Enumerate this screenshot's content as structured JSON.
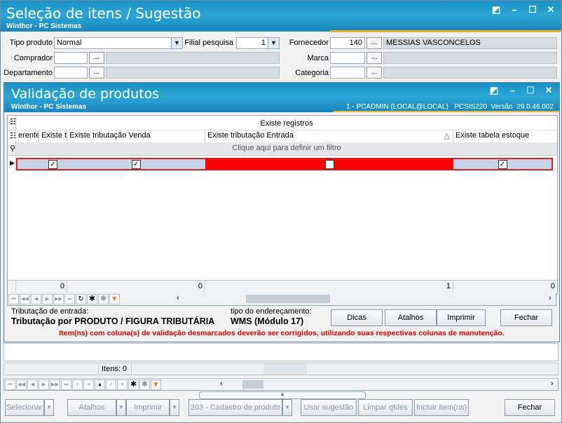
{
  "window": {
    "title": "Seleção de itens / Sugestão",
    "subtitle": "Winthor - PC Sistemas"
  },
  "filters": {
    "tipo_produto_label": "Tipo produto",
    "tipo_produto_value": "Normal",
    "filial_label": "Filial pesquisa",
    "filial_value": "1",
    "fornecedor_label": "Fornecedor",
    "fornecedor_code": "140",
    "fornecedor_name": "MESSIAS VASCONCELOS",
    "comprador_label": "Comprador",
    "marca_label": "Marca",
    "departamento_label": "Departamento",
    "categoria_label": "Categoria",
    "dots": "..."
  },
  "dialog": {
    "title": "Validação de produtos",
    "subtitle": "Winthor - PC Sistemas",
    "info": "1 - PCADMIN (LOCAL@LOCAL)   PCSIS220  Versão  29.0.46.002",
    "grid": {
      "band_header": "Existe registros",
      "columns": [
        "erente",
        "Existe t",
        "Existe tributação Venda",
        "Existe tributação Entrada",
        "Existe tabela estoque"
      ],
      "sort_indicator": "△",
      "filter_row": "Clique aqui para definir um filtro",
      "row": {
        "c1": "",
        "c2": "✓",
        "c3": "✓",
        "c4": "",
        "c5": "✓"
      },
      "row_error_color": "#ff0000",
      "totals": {
        "t1": "0",
        "t2": "0",
        "t3": "1",
        "t4": "0"
      }
    },
    "trib_entrada_label": "Tributação de entrada:",
    "trib_entrada_value": "Tributação por PRODUTO / FIGURA TRIBUTÁRIA",
    "tipo_end_label": "tipo do endereçamento:",
    "tipo_end_value": "WMS (Módulo 17)",
    "warning": "Item(ns) com coluna(s) de validação desmarcados deverão ser corrigidos, utilizando suas respectivas colunas de manutenção.",
    "buttons": {
      "dicas": "Dicas",
      "atalhos": "Atalhos",
      "imprimir": "Imprimir",
      "fechar": "Fechar"
    }
  },
  "status": {
    "itens": "Itens: 0"
  },
  "toolbar": {
    "selecionar": "Selecionar",
    "atalhos": "Atalhos",
    "imprimir": "Imprimir",
    "cadastro": "203 - Cadastro de produto",
    "usar_sugestao": "Usar sugestão",
    "limpar_qtdes": "Limpar qtdes",
    "incluir_itens": "Incluir item(ns)",
    "fechar": "Fechar"
  },
  "colors": {
    "titlebar": "#1b8fc4",
    "accent_gold": "#e0b53a",
    "warning": "#e00000"
  }
}
